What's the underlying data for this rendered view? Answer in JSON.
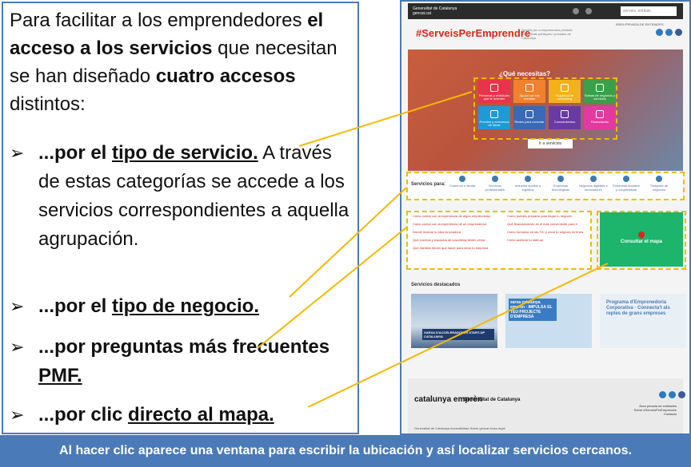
{
  "intro": {
    "p1": "Para facilitar a los emprendedores ",
    "b1": "el acceso a los servicios",
    "p2": " que necesitan se han diseñado ",
    "b2": "cuatro accesos",
    "p3": " distintos:"
  },
  "bullets": [
    {
      "pre": "...por el ",
      "u": "tipo de servicio.",
      "post": " A través de estas categorías se accede a los servicios correspondientes a aquella agrupación."
    },
    {
      "pre": "...por el ",
      "u": "tipo de negocio.",
      "post": ""
    },
    {
      "pre": "...por preguntas más frecuentes ",
      "u": "PMF.",
      "post": ""
    },
    {
      "pre": "...por clic ",
      "u": "directo al mapa.",
      "post": ""
    }
  ],
  "bullet_glyph": "➢",
  "footer": "Al hacer clic aparece una ventana para escribir la ubicación y así localizar servicios cercanos.",
  "site": {
    "logo": "Generalitat de Catalunya gencat.cat",
    "search_placeholder": "serveis, entitats",
    "brand": "#ServeisPerEmprendre",
    "brand_sub": "Serveis per a emprenedors prestats per entitats públiques i privades de Catalunya",
    "area_privada": "ÀREA PRIVADA DE ENTIDADES",
    "hero_title": "¿Qué necesitas?",
    "hero_button": "Ir a servicios",
    "tiles": [
      {
        "label": "Personas y entidades que te orienten",
        "color": "#e8344a"
      },
      {
        "label": "Ayuda con los trámites",
        "color": "#f0822e"
      },
      {
        "label": "Espacios de coworking",
        "color": "#f2b21b"
      },
      {
        "label": "Bolsas de negocios y servicios",
        "color": "#3aa04a"
      },
      {
        "label": "Premios y concursos de ideas",
        "color": "#1e9ad6"
      },
      {
        "label": "Redes para conectar",
        "color": "#3a69b6"
      },
      {
        "label": "Conocimientos",
        "color": "#6a3aa4"
      },
      {
        "label": "Financiación",
        "color": "#e23aa0"
      }
    ],
    "services_label": "Servicios para:",
    "services": [
      "Comercio o tienda",
      "Servicios profesionales",
      "Industria auxiliar y logística",
      "Empresas tecnológicas",
      "Negocios digitales e innovadores",
      "Empresas sociales y cooperativas",
      "Trasporte de negocios"
    ],
    "faq": [
      "Cómo contar con la experiencia de algún emprendedor",
      "Cómo contar con la experiencia de un emprendedor",
      "Dónde incubar tu idea innovadora",
      "Qué eventos y espacios de coworking tienen cerca",
      "Qué trámites tienen que hacer para crear tu empresa",
      "Cómo puedes preparar para llegar tu negocio",
      "Qué financiamiento es el más conveniente para ti",
      "Cómo formarse en las TIC y crear tu negocio en línea",
      "Cómo acelerar tu start-up"
    ],
    "map_label": "Consultar el mapa",
    "featured_title": "Servicios destacados",
    "cards": [
      {
        "caption": "XARXA D'ACCELERADORES START-UP CATALUNYA"
      },
      {
        "caption": "xarxa catalunya emprèn · IMPULSA EL TEU PROJECTE D'EMPRESA"
      },
      {
        "caption": "Programa d'Emprenedoria Corporativa · Connecta't als reptes de grans empreses"
      }
    ],
    "footer_logo": "catalunya emprèn",
    "footer_gen": "Generalitat de Catalunya",
    "footer_links": [
      "Área privada de entidades",
      "Sobre #ServeisPerEmprendre",
      "Contacto"
    ],
    "footer_bottom": "Generalitat de Catalunya    Accesibilidad    Sobre gencat    Aviso legal"
  }
}
